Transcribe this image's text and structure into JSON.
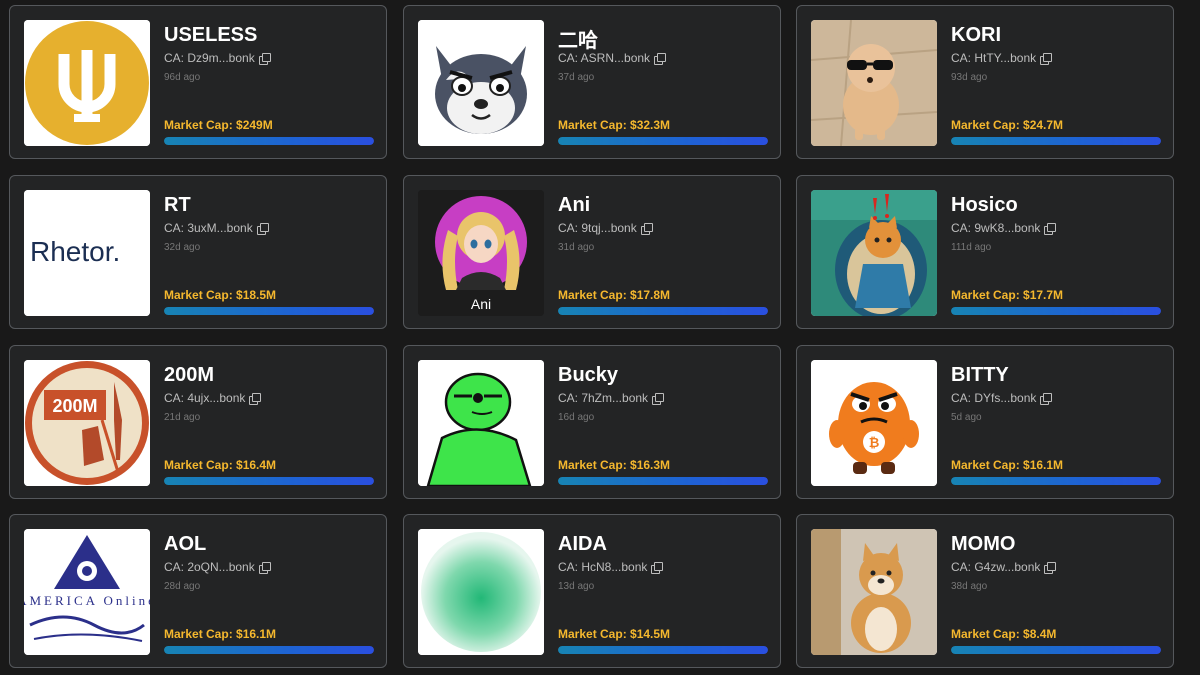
{
  "market_cap_label": "Market Cap: ",
  "copy_icon": "copy-icon",
  "bar_colors": {
    "from": "#1784b4",
    "to": "#2a4fe0"
  },
  "text_colors": {
    "market_cap": "#f5b82e",
    "name": "#ffffff"
  },
  "tokens": [
    {
      "name": "USELESS",
      "ca": "CA: Dz9m...bonk",
      "age": "96d ago",
      "market_cap": "$249M",
      "market_cap_text": "Market Cap: $249M",
      "progress": 1.0
    },
    {
      "name": "二哈",
      "ca": "CA: ASRN...bonk",
      "age": "37d ago",
      "market_cap": "$32.3M",
      "market_cap_text": "Market Cap: $32.3M",
      "progress": 1.0
    },
    {
      "name": "KORI",
      "ca": "CA: HtTY...bonk",
      "age": "93d ago",
      "market_cap": "$24.7M",
      "market_cap_text": "Market Cap: $24.7M",
      "progress": 1.0
    },
    {
      "name": "RT",
      "ca": "CA: 3uxM...bonk",
      "age": "32d ago",
      "market_cap": "$18.5M",
      "market_cap_text": "Market Cap: $18.5M",
      "progress": 1.0
    },
    {
      "name": "Ani",
      "ca": "CA: 9tqj...bonk",
      "age": "31d ago",
      "market_cap": "$17.8M",
      "market_cap_text": "Market Cap: $17.8M",
      "progress": 1.0,
      "image_text": "Ani"
    },
    {
      "name": "Hosico",
      "ca": "CA: 9wK8...bonk",
      "age": "111d ago",
      "market_cap": "$17.7M",
      "market_cap_text": "Market Cap: $17.7M",
      "progress": 1.0
    },
    {
      "name": "200M",
      "ca": "CA: 4ujx...bonk",
      "age": "21d ago",
      "market_cap": "$16.4M",
      "market_cap_text": "Market Cap: $16.4M",
      "progress": 1.0,
      "image_text": "200M"
    },
    {
      "name": "Bucky",
      "ca": "CA: 7hZm...bonk",
      "age": "16d ago",
      "market_cap": "$16.3M",
      "market_cap_text": "Market Cap: $16.3M",
      "progress": 1.0
    },
    {
      "name": "BITTY",
      "ca": "CA: DYfs...bonk",
      "age": "5d ago",
      "market_cap": "$16.1M",
      "market_cap_text": "Market Cap: $16.1M",
      "progress": 1.0
    },
    {
      "name": "AOL",
      "ca": "CA: 2oQN...bonk",
      "age": "28d ago",
      "market_cap": "$16.1M",
      "market_cap_text": "Market Cap: $16.1M",
      "progress": 1.0,
      "image_text": "AMERICA Online"
    },
    {
      "name": "AIDA",
      "ca": "CA: HcN8...bonk",
      "age": "13d ago",
      "market_cap": "$14.5M",
      "market_cap_text": "Market Cap: $14.5M",
      "progress": 1.0
    },
    {
      "name": "MOMO",
      "ca": "CA: G4zw...bonk",
      "age": "38d ago",
      "market_cap": "$8.4M",
      "market_cap_text": "Market Cap: $8.4M",
      "progress": 1.0
    }
  ],
  "rhetor_logo_text": "Rhetor."
}
